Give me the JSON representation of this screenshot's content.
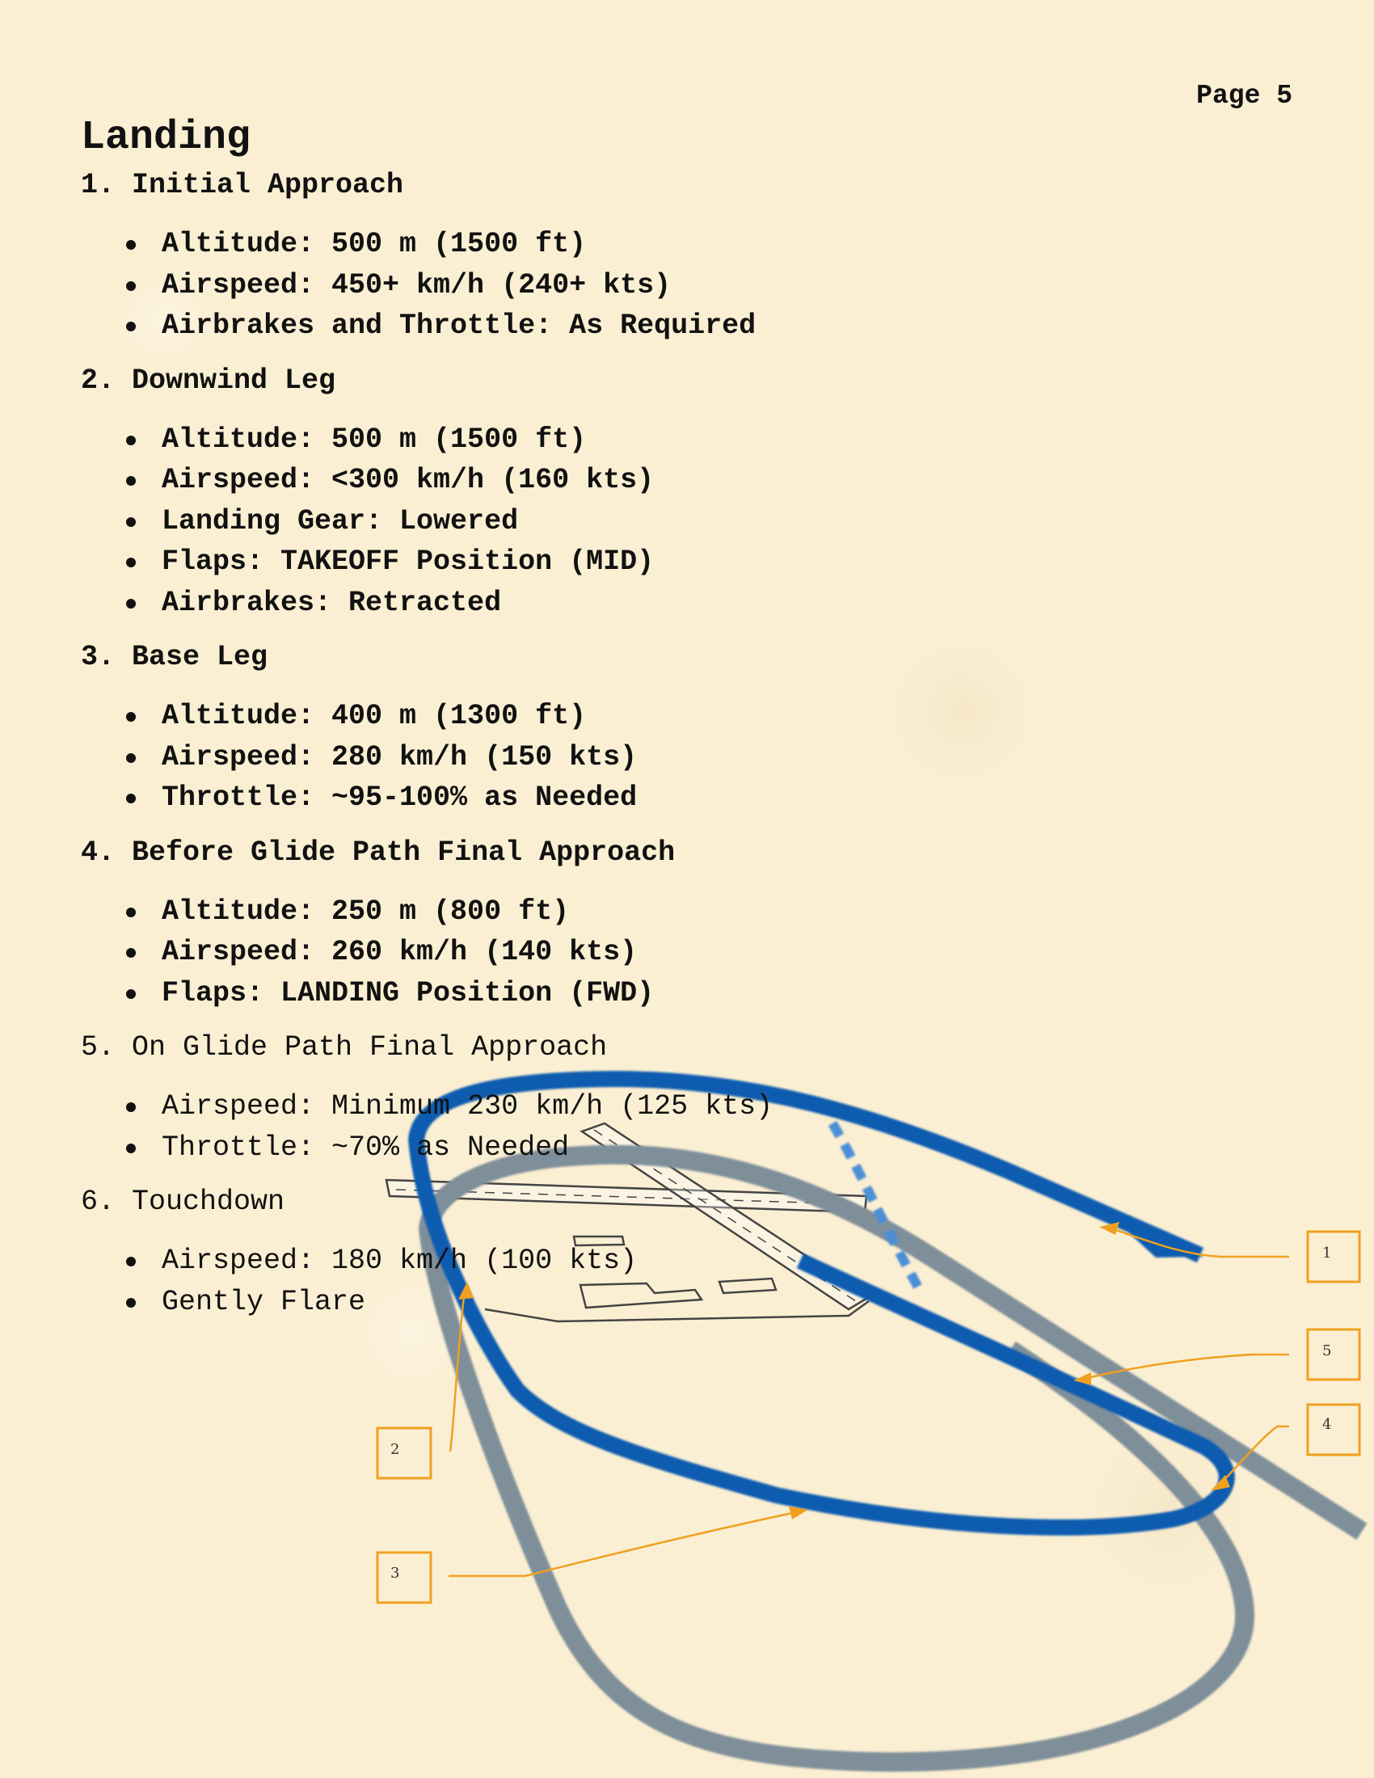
{
  "page_label": "Page 5",
  "title": "Landing",
  "steps": [
    {
      "heading": "1. Initial Approach",
      "items": [
        "Altitude: 500 m (1500 ft)",
        "Airspeed: 450+ km/h (240+ kts)",
        "Airbrakes and Throttle: As Required"
      ]
    },
    {
      "heading": "2. Downwind Leg",
      "items": [
        "Altitude: 500 m (1500 ft)",
        "Airspeed: <300 km/h (160 kts)",
        "Landing Gear: Lowered",
        "Flaps: TAKEOFF Position (MID)",
        "Airbrakes: Retracted"
      ]
    },
    {
      "heading": "3. Base Leg",
      "items": [
        "Altitude: 400 m (1300 ft)",
        "Airspeed: 280 km/h (150 kts)",
        "Throttle: ~95-100% as Needed"
      ]
    },
    {
      "heading": "4. Before Glide Path Final Approach",
      "items": [
        "Altitude: 250 m (800 ft)",
        "Airspeed: 260 km/h (140 kts)",
        "Flaps: LANDING Position (FWD)"
      ]
    },
    {
      "heading": "5. On Glide Path Final Approach",
      "items": [
        "Airspeed: Minimum 230 km/h (125 kts)",
        "Throttle: ~70% as Needed"
      ]
    },
    {
      "heading": "6. Touchdown",
      "items": [
        "Airspeed: 180 km/h (100 kts)",
        "Gently Flare"
      ]
    }
  ],
  "diagram": {
    "callouts": [
      "1",
      "2",
      "3",
      "4",
      "5"
    ],
    "colors": {
      "flight_path": "#0e5bb0",
      "traffic_pattern": "#7f8f9a",
      "callout": "#f0a020",
      "airfield_lines": "#444444"
    }
  }
}
